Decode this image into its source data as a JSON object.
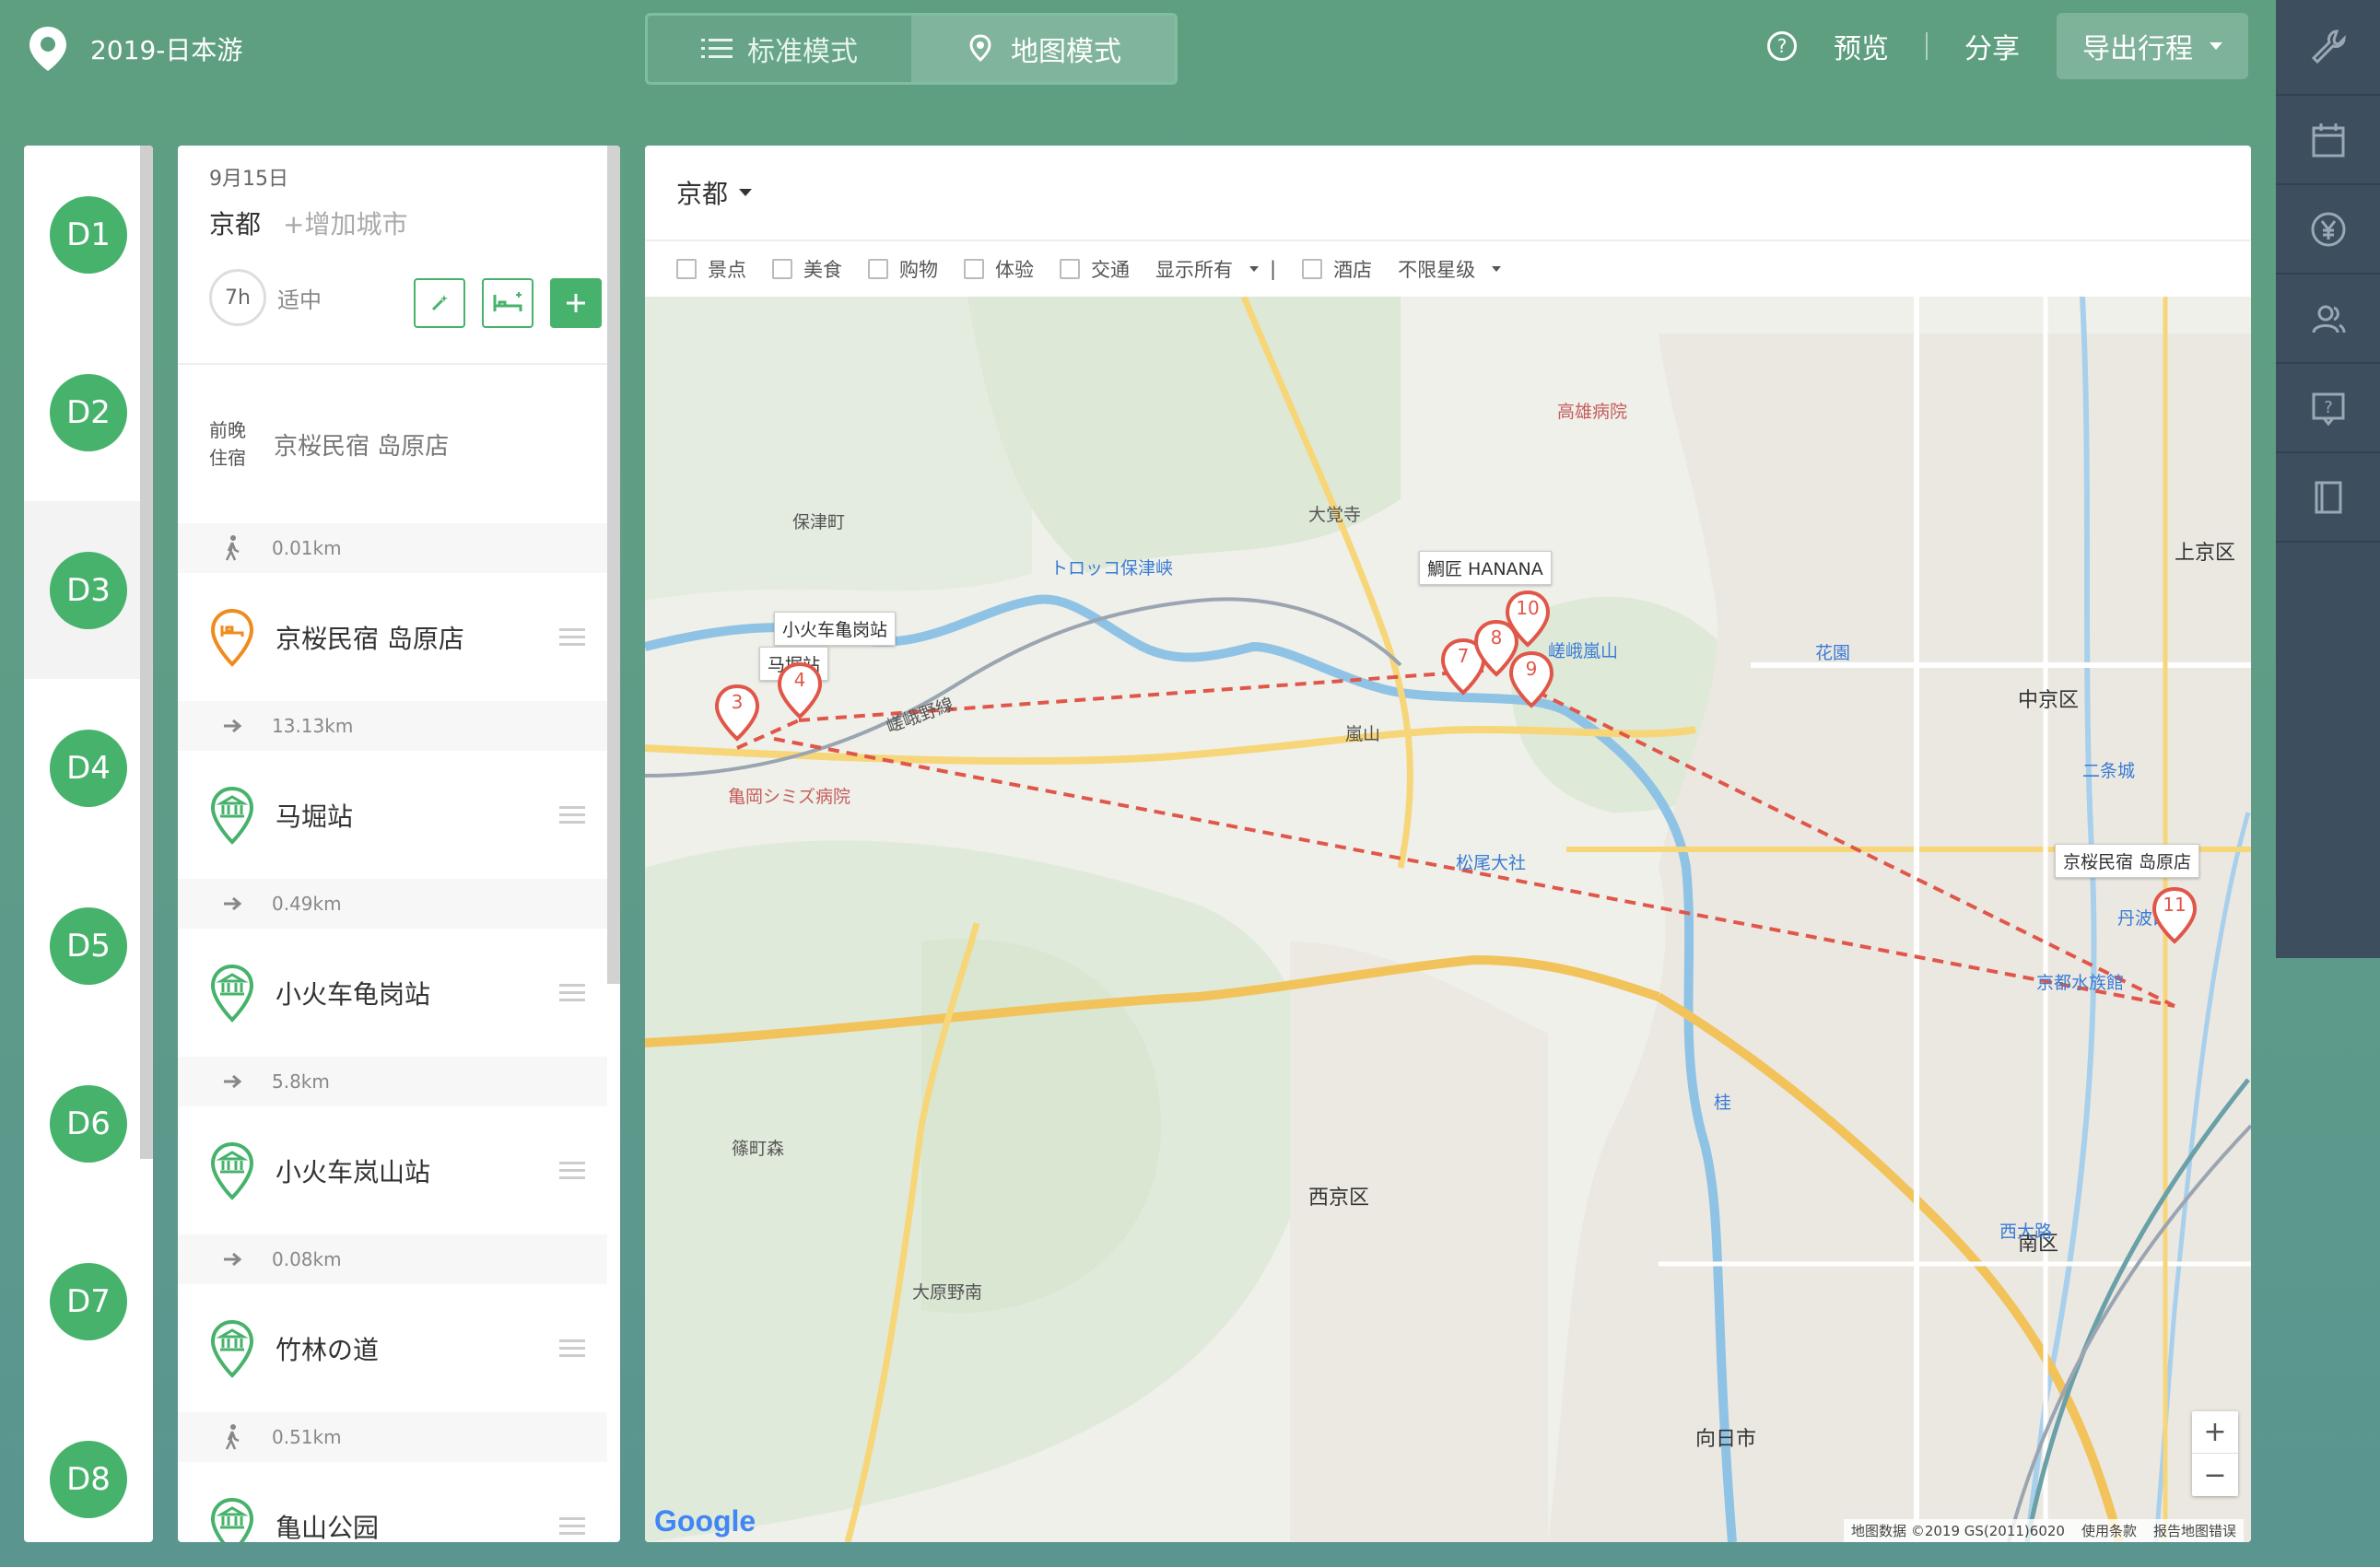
{
  "app": {
    "title": "2019-日本游",
    "modes": [
      {
        "label": "标准模式",
        "icon": "list-icon",
        "active": false
      },
      {
        "label": "地图模式",
        "icon": "map-pin-icon",
        "active": true
      }
    ],
    "preview_label": "预览",
    "share_label": "分享",
    "export_label": "导出行程"
  },
  "days": [
    "D1",
    "D2",
    "D3",
    "D4",
    "D5",
    "D6",
    "D7",
    "D8"
  ],
  "selected_day": "D3",
  "itinerary": {
    "date": "9月15日",
    "city": "京都",
    "add_city": "+增加城市",
    "duration": "7h",
    "pace": "适中",
    "stay": {
      "label_line1": "前晚",
      "label_line2": "住宿",
      "name": "京桜民宿 岛原店"
    },
    "segments": [
      {
        "mode": "walk-icon",
        "distance": "0.01km"
      },
      {
        "stop": "京桜民宿 岛原店",
        "type": "hotel"
      },
      {
        "mode": "arrow-icon",
        "distance": "13.13km"
      },
      {
        "stop": "马堀站",
        "type": "station"
      },
      {
        "mode": "arrow-icon",
        "distance": "0.49km"
      },
      {
        "stop": "小火车龟岗站",
        "type": "station"
      },
      {
        "mode": "arrow-icon",
        "distance": "5.8km"
      },
      {
        "stop": "小火车岚山站",
        "type": "station"
      },
      {
        "mode": "arrow-icon",
        "distance": "0.08km"
      },
      {
        "stop": "竹林の道",
        "type": "station"
      },
      {
        "mode": "walk-icon",
        "distance": "0.51km"
      },
      {
        "stop": "亀山公园",
        "type": "station"
      }
    ]
  },
  "map": {
    "city": "京都",
    "filters": [
      "景点",
      "美食",
      "购物",
      "体验",
      "交通"
    ],
    "show_all": "显示所有",
    "hotel": "酒店",
    "stars": "不限星级",
    "callouts": [
      "小火车亀岗站",
      "马堀站",
      "鯛匠 HANANA",
      "京桜民宿 岛原店"
    ],
    "markers": [
      "3",
      "4",
      "7",
      "8",
      "9",
      "10",
      "11"
    ],
    "zoom_in": "+",
    "zoom_out": "−",
    "attribution": [
      "地图数据 ©2019 GS(2011)6020",
      "使用条款",
      "报告地图错误"
    ],
    "google": "Google",
    "labels": {
      "hoshimachi": "保津町",
      "ohara": "大原野南",
      "nishikyo": "西京区",
      "chukyo": "中京区",
      "kamigyo": "上京区",
      "minami": "南区",
      "muko": "向日市",
      "arashiyama": "嵐山",
      "sagano": "嵯峨野線",
      "matsuo": "松尾大社",
      "katsura": "桂",
      "kyoto_aquarium": "京都水族館",
      "kameoka_hosp": "亀岡シミズ病院",
      "takao_hosp": "高雄病院",
      "shinodacho": "篠町森",
      "daikakuji": "大覚寺",
      "nishiojo": "西大路",
      "tanbaguchi": "丹波口",
      "nijo": "二条城",
      "hanazono": "花園",
      "sagaarashiyama": "嵯峨嵐山",
      "torokko": "トロッコ保津峡"
    }
  }
}
